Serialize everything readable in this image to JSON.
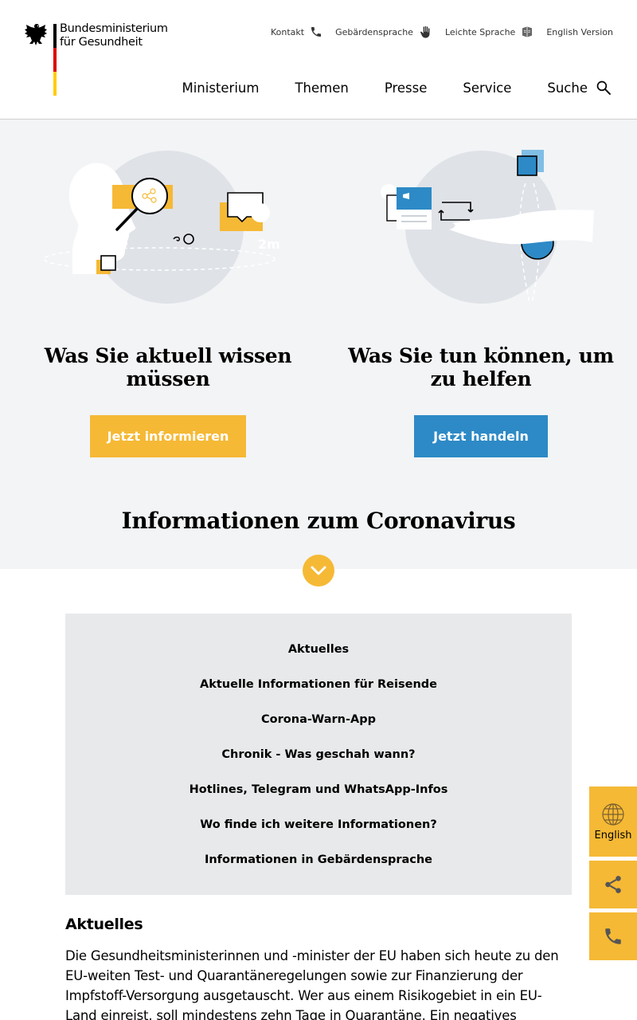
{
  "logo": {
    "line1": "Bundesministerium",
    "line2": "für Gesundheit",
    "flag_colors": [
      "#000000",
      "#dd0000",
      "#ffcc00"
    ]
  },
  "top_nav": {
    "contact": "Kontakt",
    "sign_language": "Gebärdensprache",
    "easy_language": "Leichte Sprache",
    "english": "English Version"
  },
  "main_nav": {
    "ministry": "Ministerium",
    "topics": "Themen",
    "press": "Presse",
    "service": "Service",
    "search": "Suche"
  },
  "hero": {
    "left_title": "Was Sie aktuell wissen müssen",
    "left_button": "Jetzt informieren",
    "right_title": "Was Sie tun können, um zu helfen",
    "right_button": "Jetzt handeln",
    "distance_label": "2m",
    "section_heading": "Informationen zum Coronavirus"
  },
  "toc": {
    "links": [
      "Aktuelles",
      "Aktuelle Informationen für Reisende",
      "Corona-Warn-App",
      "Chronik - Was geschah wann?",
      "Hotlines, Telegram und WhatsApp-Infos",
      "Wo finde ich weitere Informationen?",
      "Informationen in Gebärdensprache"
    ]
  },
  "article": {
    "heading": "Aktuelles",
    "body": "Die Gesundheitsministerinnen und -minister der EU haben sich heute zu den EU-weiten Test- und Quarantäneregelungen sowie zur Finanzierung der Impfstoff-Versorgung ausgetauscht. Wer aus einem Risikogebiet in ein EU-Land einreist, soll mindestens zehn Tage in Quarantäne. Ein negatives Testergebnis könnte die"
  },
  "side_widgets": {
    "language_label": "English"
  },
  "colors": {
    "accent_yellow": "#f5b935",
    "accent_blue": "#2d8ac6",
    "hero_bg": "#f3f4f6",
    "toc_bg": "#e8e9ea"
  }
}
